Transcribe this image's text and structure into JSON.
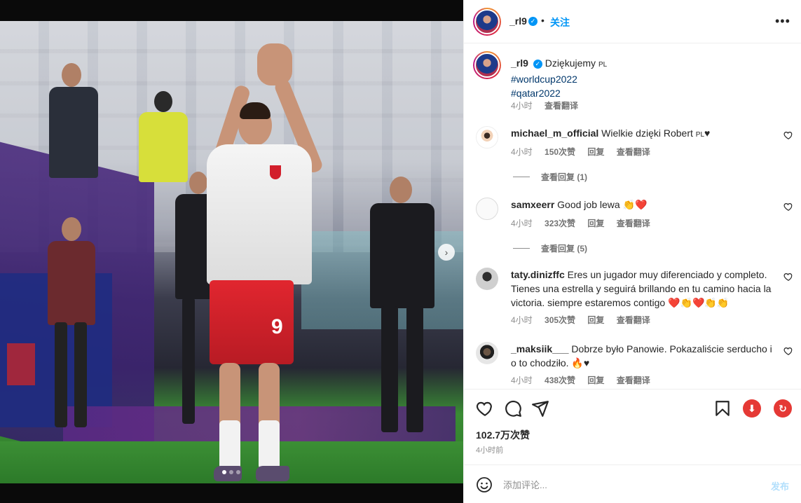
{
  "post": {
    "username": "_rl9",
    "follow_label": "关注",
    "separator": "•",
    "more_icon": "more-horizontal-icon"
  },
  "caption": {
    "username": "_rl9",
    "text": "Dziękujemy",
    "flag": "PL",
    "hashtags": [
      "#worldcup2022",
      "#qatar2022"
    ],
    "time": "4小时",
    "translate_label": "查看翻译"
  },
  "comments": [
    {
      "username": "michael_m_official",
      "text": "Wielkie dzięki Robert",
      "flag_suffix": "PL",
      "emoji": "♥",
      "time": "4小时",
      "likes": "150次赞",
      "reply_label": "回复",
      "translate_label": "查看翻译",
      "view_replies": "查看回复 (1)"
    },
    {
      "username": "samxeerr",
      "text": "Good job lewa",
      "emoji": "👏❤️",
      "time": "4小时",
      "likes": "323次赞",
      "reply_label": "回复",
      "translate_label": "查看翻译",
      "view_replies": "查看回复 (5)"
    },
    {
      "username": "taty.dinizffc",
      "text": "Eres un jugador muy diferenciado y completo. Tienes una estrella y seguirá brillando en tu camino hacia la victoria. siempre estaremos contigo",
      "emoji": "❤️👏❤️👏👏",
      "time": "4小时",
      "likes": "305次赞",
      "reply_label": "回复",
      "translate_label": "查看翻译"
    },
    {
      "username": "_maksiik___",
      "text": "Dobrze było Panowie. Pokazaliście serducho i o to chodziło.",
      "emoji": "🔥♥",
      "time": "4小时",
      "likes": "438次赞",
      "reply_label": "回复",
      "translate_label": "查看翻译"
    }
  ],
  "stats": {
    "likes": "102.7万次赞",
    "time_ago": "4小时前"
  },
  "composer": {
    "placeholder": "添加评论...",
    "post_label": "发布"
  },
  "media": {
    "jersey_number": "9",
    "carousel_total": 3,
    "carousel_active": 1
  },
  "colors": {
    "accent": "#0095f6",
    "verified": "#0095f6",
    "download_ext": "#e53935",
    "refresh_ext": "#e53935"
  }
}
